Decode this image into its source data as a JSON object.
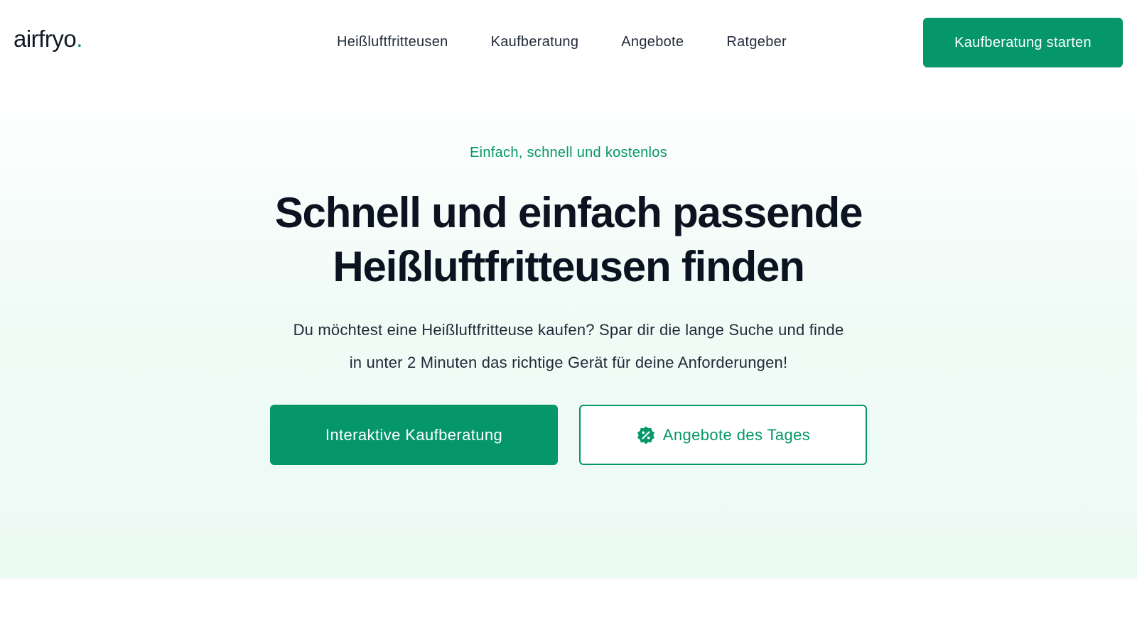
{
  "header": {
    "logo_text": "airfryo",
    "logo_dot": ".",
    "nav": [
      {
        "label": "Heißluftfritteusen"
      },
      {
        "label": "Kaufberatung"
      },
      {
        "label": "Angebote"
      },
      {
        "label": "Ratgeber"
      }
    ],
    "cta_label": "Kaufberatung starten"
  },
  "hero": {
    "eyebrow": "Einfach, schnell und kostenlos",
    "headline_line1": "Schnell und einfach passende",
    "headline_line2": "Heißluftfritteusen finden",
    "subtext_line1": "Du möchtest eine Heißluftfritteuse kaufen? Spar dir die lange Suche und finde",
    "subtext_line2": "in unter 2 Minuten das richtige Gerät für deine Anforderungen!",
    "primary_button": "Interaktive Kaufberatung",
    "secondary_button": "Angebote des Tages",
    "secondary_icon": "discount-badge-icon"
  },
  "colors": {
    "brand": "#059669",
    "text": "#111827"
  }
}
